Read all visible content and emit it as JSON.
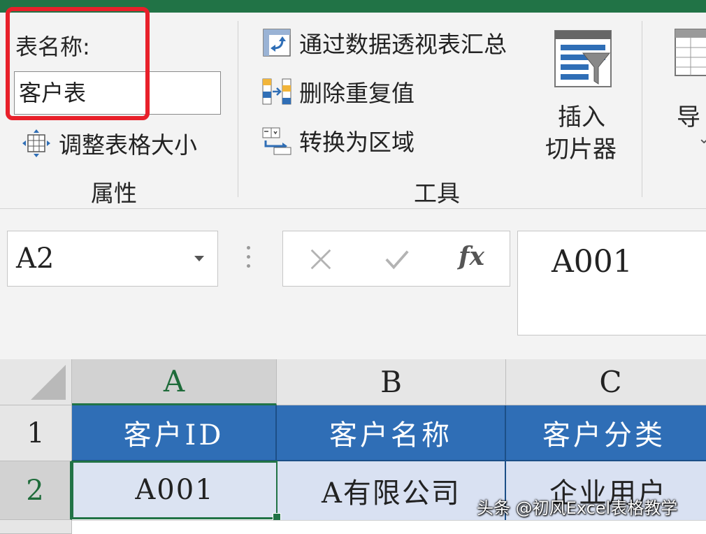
{
  "ribbon": {
    "properties": {
      "table_name_label": "表名称:",
      "table_name_value": "客户表",
      "resize_table_label": "调整表格大小",
      "group_label": "属性"
    },
    "tools": {
      "pivot_summarize_label": "通过数据透视表汇总",
      "remove_duplicates_label": "删除重复值",
      "convert_to_range_label": "转换为区域",
      "group_label": "工具"
    },
    "insert_slicer": {
      "line1": "插入",
      "line2": "切片器"
    },
    "export_partial": {
      "label": "导"
    },
    "accent_color": "#217346",
    "highlight_color": "#e8202a"
  },
  "formula_bar": {
    "name_box": "A2",
    "fx_label": "fx",
    "content": "A001"
  },
  "grid": {
    "columns": [
      "A",
      "B",
      "C"
    ],
    "rows": [
      "1",
      "2"
    ],
    "header_row": [
      "客户ID",
      "客户名称",
      "客户分类"
    ],
    "data_row": [
      "A001",
      "A有限公司",
      "企业用户"
    ],
    "header_fill": "#2f6eb6",
    "data_fill": "#d9e1f2"
  },
  "watermark": {
    "text": "头条 @初风Excel表格教学"
  }
}
